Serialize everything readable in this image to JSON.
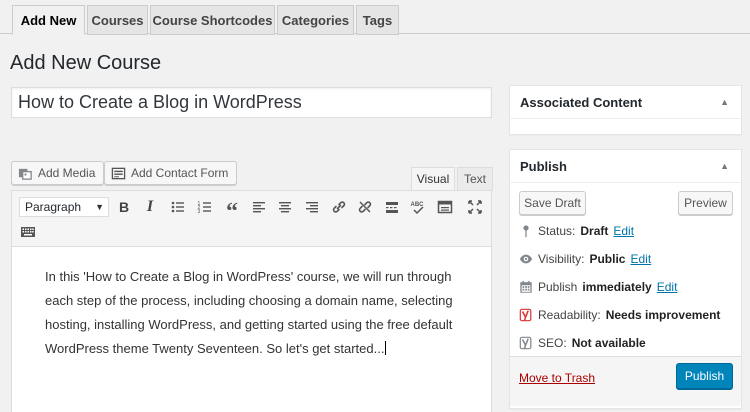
{
  "tabs": [
    {
      "label": "Add New",
      "active": true
    },
    {
      "label": "Courses"
    },
    {
      "label": "Course Shortcodes"
    },
    {
      "label": "Categories"
    },
    {
      "label": "Tags"
    }
  ],
  "page_title": "Add New Course",
  "title_value": "How to Create a Blog in WordPress",
  "media_buttons": {
    "add_media": "Add Media",
    "add_contact_form": "Add Contact Form"
  },
  "editor_modes": {
    "visual": "Visual",
    "text": "Text"
  },
  "toolbar": {
    "format_value": "Paragraph",
    "icons": [
      "bold-icon",
      "italic-icon",
      "bullet-list-icon",
      "numbered-list-icon",
      "blockquote-icon",
      "align-left-icon",
      "align-center-icon",
      "align-right-icon",
      "link-icon",
      "unlink-icon",
      "read-more-icon",
      "spellcheck-icon",
      "fullscreen-icon",
      "distraction-free-icon",
      "toolbar-toggle-icon"
    ]
  },
  "editor_content": {
    "lines": [
      "In this 'How to Create a Blog in WordPress' course, we will run through",
      "each step of the process, including choosing a domain name, selecting",
      "hosting, installing WordPress, and getting started using the free default",
      "WordPress theme Twenty Seventeen. So let's get started..."
    ]
  },
  "associated_content": {
    "title": "Associated Content"
  },
  "publish_box": {
    "title": "Publish",
    "save_draft": "Save Draft",
    "preview": "Preview",
    "status_label": "Status:",
    "status_value": "Draft",
    "visibility_label": "Visibility:",
    "visibility_value": "Public",
    "publish_label": "Publish",
    "publish_value": "immediately",
    "edit": "Edit",
    "readability_label": "Readability:",
    "readability_value": "Needs improvement",
    "seo_label": "SEO:",
    "seo_value": "Not available",
    "move_to_trash": "Move to Trash",
    "publish_button": "Publish"
  },
  "colors": {
    "accent": "#0085ba",
    "link": "#0073aa",
    "trash": "#a00000",
    "readability": "#dc3232"
  }
}
